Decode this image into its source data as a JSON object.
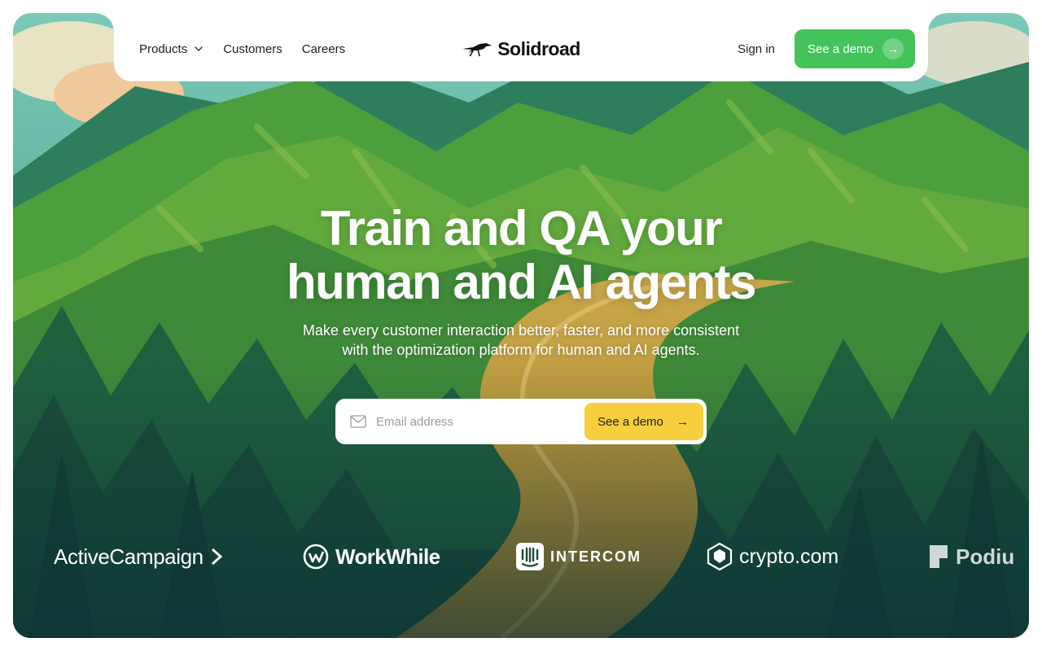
{
  "nav": {
    "products_label": "Products",
    "customers_label": "Customers",
    "careers_label": "Careers",
    "brand_name": "Solidroad",
    "sign_in_label": "Sign in",
    "demo_label": "See a demo"
  },
  "hero": {
    "headline_line1": "Train and QA your",
    "headline_line2": "human and AI agents",
    "subhead_line1": "Make every customer interaction better, faster, and more consistent",
    "subhead_line2": "with the optimization platform for human and AI agents.",
    "email_placeholder": "Email address",
    "cta_label": "See a demo"
  },
  "logos": [
    {
      "name": "ActiveCampaign"
    },
    {
      "name": "WorkWhile"
    },
    {
      "name": "INTERCOM"
    },
    {
      "name": "crypto.com"
    },
    {
      "name": "Podiu"
    }
  ],
  "colors": {
    "green_button": "#43c35a",
    "yellow_button": "#f6ce3e"
  },
  "icons": {
    "brand_logo": "roadrunner-bird-icon",
    "products_chevron": "chevron-down-icon",
    "demo_arrow": "arrow-right-icon",
    "email_field": "mail-icon"
  }
}
